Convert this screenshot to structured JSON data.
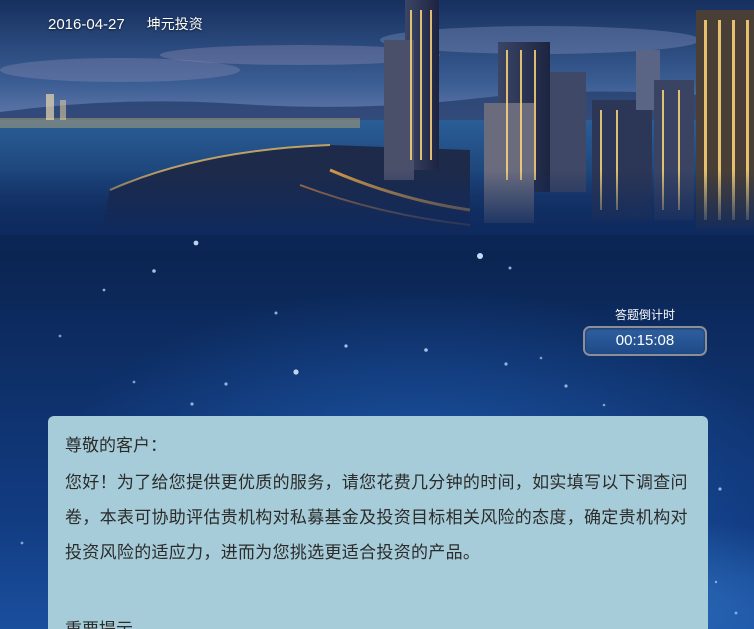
{
  "header": {
    "date": "2016-04-27",
    "brand": "坤元投资"
  },
  "timer": {
    "label": "答题倒计时",
    "value": "00:15:08"
  },
  "intro": {
    "greeting": "尊敬的客户：",
    "body": "您好！为了给您提供更优质的服务，请您花费几分钟的时间，如实填写以下调查问卷，本表可协助评估贵机构对私募基金及投资目标相关风险的态度，确定贵机构对投资风险的适应力，进而为您挑选更适合投资的产品。",
    "notice_heading": "重要提示"
  },
  "colors": {
    "page_background": "#0b2553",
    "panel_background": "#a6ccd9",
    "timer_background": "#2a5a9a"
  }
}
